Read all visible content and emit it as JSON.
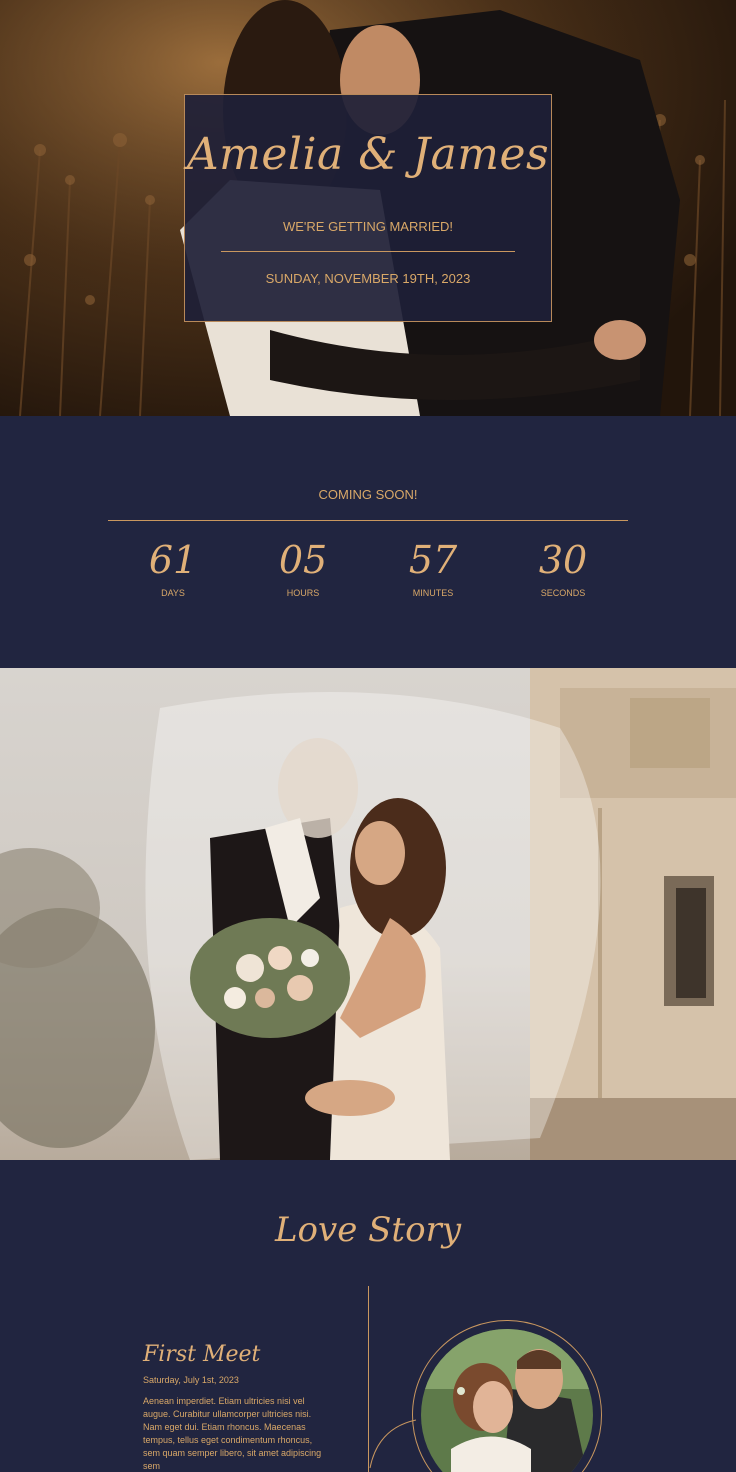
{
  "hero": {
    "names": "Amelia & James",
    "subtitle": "WE'RE GETTING MARRIED!",
    "date": "SUNDAY, NOVEMBER 19TH, 2023"
  },
  "countdown": {
    "heading": "COMING SOON!",
    "units": [
      {
        "value": "61",
        "label": "DAYS"
      },
      {
        "value": "05",
        "label": "HOURS"
      },
      {
        "value": "57",
        "label": "MINUTES"
      },
      {
        "value": "30",
        "label": "SECONDS"
      }
    ]
  },
  "story": {
    "title": "Love Story",
    "items": [
      {
        "title": "First Meet",
        "date": "Saturday, July 1st, 2023",
        "body": "Aenean imperdiet. Etiam ultricies nisi vel augue. Curabitur ullamcorper ultricies nisi. Nam eget dui. Etiam rhoncus. Maecenas tempus, tellus eget condimentum rhoncus, sem quam semper libero, sit amet adipiscing sem"
      }
    ]
  },
  "colors": {
    "navy": "#212540",
    "gold": "#d9a868"
  }
}
